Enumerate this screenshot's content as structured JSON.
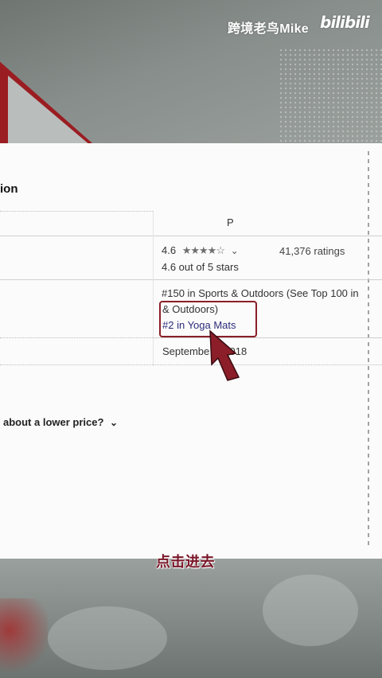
{
  "watermark": {
    "author": "跨境老鸟Mike",
    "brand": "bilibili"
  },
  "page": {
    "section_title": "ion",
    "p_letter": "P",
    "rating": {
      "value": "4.6",
      "stars": "★★★★☆",
      "out_of": "4.6 out of 5 stars",
      "count": "41,376 ratings"
    },
    "ranks": {
      "line1": "#150 in Sports & Outdoors (See Top 100 in",
      "line2": "& Outdoors)",
      "line3": "#2 in Yoga Mats"
    },
    "date": "Septembe  2, 2018",
    "lower_price": "about a lower price?"
  },
  "subtitle": "点击进去",
  "colors": {
    "highlight": "#8b1e28",
    "arrow": "#8b1e28"
  },
  "icons": {
    "chevron": "chevron-down-icon",
    "arrow": "pointer-arrow-icon"
  }
}
